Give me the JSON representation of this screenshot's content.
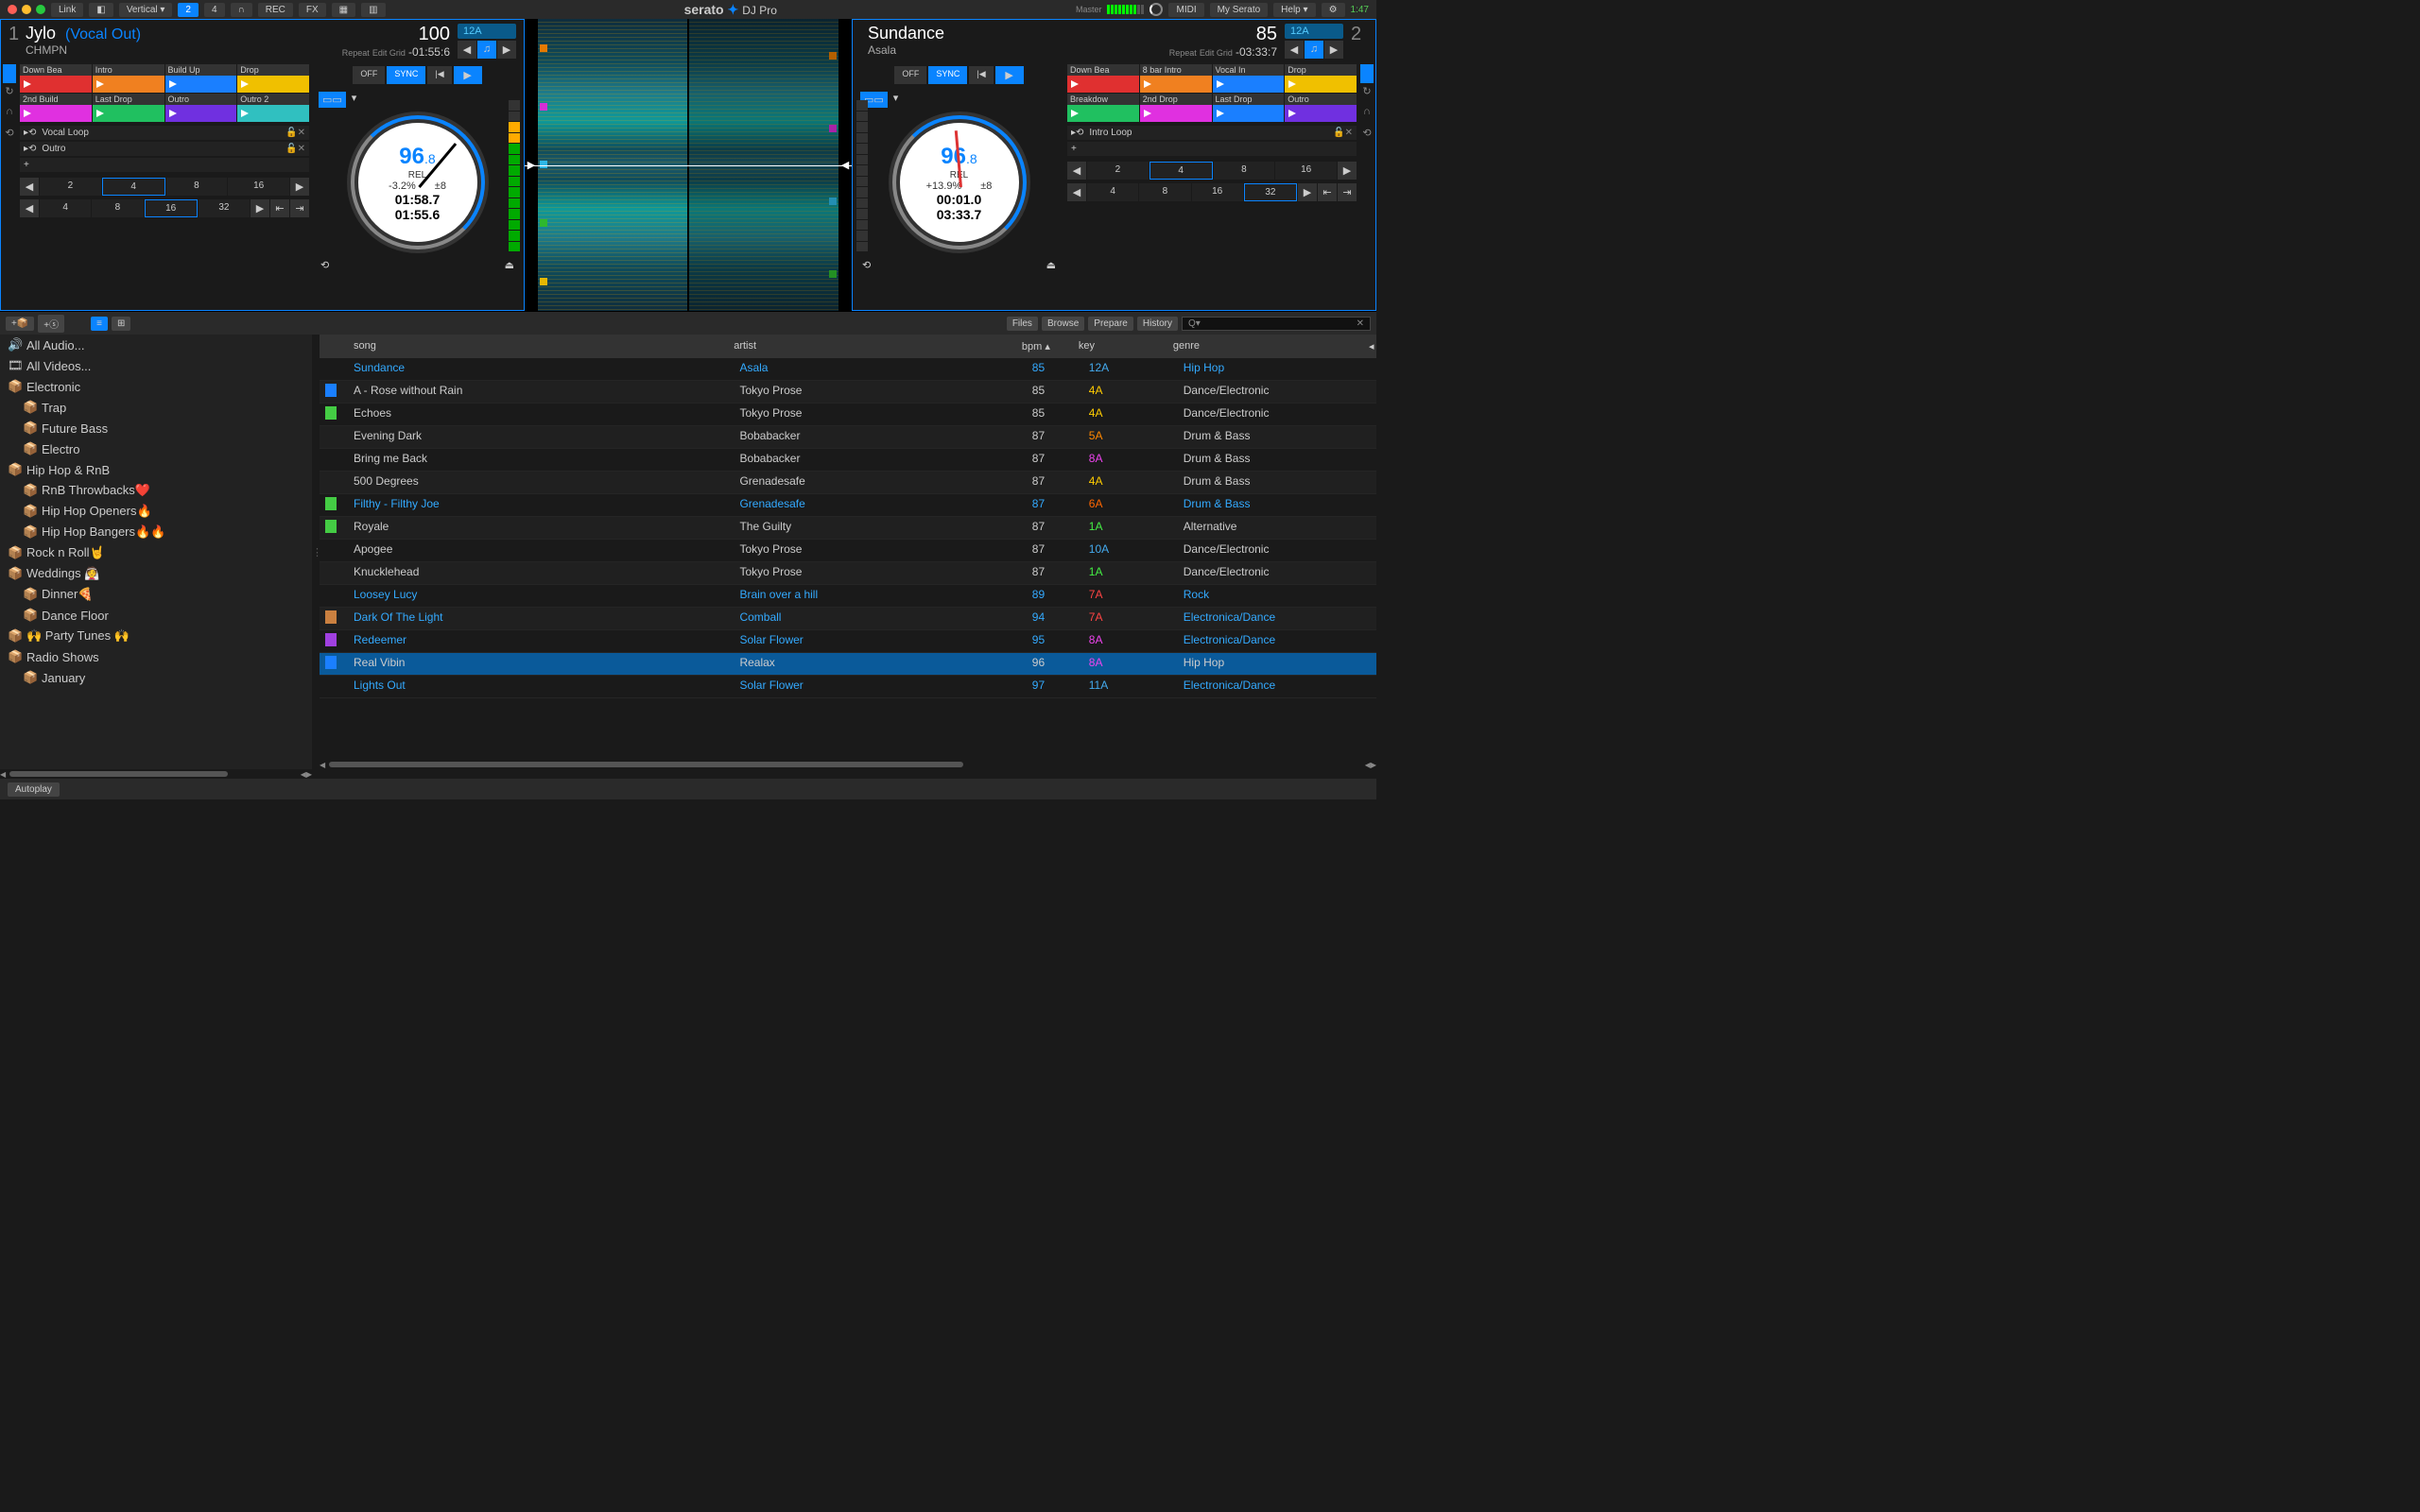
{
  "topbar": {
    "link": "Link",
    "vertical": "Vertical",
    "mode2": "2",
    "mode4": "4",
    "rec": "REC",
    "fx": "FX",
    "master": "Master",
    "midi": "MIDI",
    "myserato": "My Serato",
    "help": "Help",
    "clock": "1:47"
  },
  "brand": {
    "main": "serato",
    "sub": "DJ Pro"
  },
  "deck1": {
    "num": "1",
    "title": "Jylo",
    "artist": "CHMPN",
    "vocal": "(Vocal Out)",
    "bpm": "100",
    "key": "12A",
    "time": "-01:55:6",
    "repeat": "Repeat",
    "editgrid": "Edit Grid",
    "cues": [
      {
        "label": "Down Bea",
        "color": "#e03030"
      },
      {
        "label": "Intro",
        "color": "#f08020"
      },
      {
        "label": "Build Up",
        "color": "#1a7fff"
      },
      {
        "label": "Drop",
        "color": "#f0c000"
      },
      {
        "label": "2nd Build",
        "color": "#e030e0"
      },
      {
        "label": "Last Drop",
        "color": "#20c060"
      },
      {
        "label": "Outro",
        "color": "#7030e0"
      },
      {
        "label": "Outro 2",
        "color": "#30c0c0"
      }
    ],
    "loops": [
      "Vocal Loop",
      "Outro"
    ],
    "beats1": [
      "2",
      "4",
      "8",
      "16"
    ],
    "beats1_active": "4",
    "beats2": [
      "4",
      "8",
      "16",
      "32"
    ],
    "beats2_active": "16",
    "platter_bpm": "96",
    "platter_bpm_dec": ".8",
    "platter_rel": "REL",
    "pitch_pct": "-3.2%",
    "pitch_range": "±8",
    "elapsed": "01:58.7",
    "remain": "01:55.6",
    "off": "OFF",
    "sync": "SYNC"
  },
  "deck2": {
    "num": "2",
    "title": "Sundance",
    "artist": "Asala",
    "bpm": "85",
    "key": "12A",
    "time": "-03:33:7",
    "repeat": "Repeat",
    "editgrid": "Edit Grid",
    "cues": [
      {
        "label": "Down Bea",
        "color": "#e03030"
      },
      {
        "label": "8 bar Intro",
        "color": "#f08020"
      },
      {
        "label": "Vocal In",
        "color": "#1a7fff"
      },
      {
        "label": "Drop",
        "color": "#f0c000"
      },
      {
        "label": "Breakdow",
        "color": "#20c060"
      },
      {
        "label": "2nd Drop",
        "color": "#e030e0"
      },
      {
        "label": "Last Drop",
        "color": "#1a7fff"
      },
      {
        "label": "Outro",
        "color": "#7030e0"
      }
    ],
    "loops": [
      "Intro Loop"
    ],
    "beats1": [
      "2",
      "4",
      "8",
      "16"
    ],
    "beats1_active": "4",
    "beats2": [
      "4",
      "8",
      "16",
      "32"
    ],
    "beats2_active": "32",
    "platter_bpm": "96",
    "platter_bpm_dec": ".8",
    "platter_rel": "REL",
    "pitch_pct": "+13.9%",
    "pitch_range": "±8",
    "elapsed": "00:01.0",
    "remain": "03:33.7",
    "off": "OFF",
    "sync": "SYNC"
  },
  "library_tabs": {
    "files": "Files",
    "browse": "Browse",
    "prepare": "Prepare",
    "history": "History"
  },
  "search_placeholder": "Q▾",
  "crates": [
    {
      "label": "All Audio...",
      "icon": "🔊",
      "indent": 0
    },
    {
      "label": "All Videos...",
      "icon": "🎞",
      "indent": 0
    },
    {
      "label": "Electronic",
      "icon": "📦",
      "indent": 0
    },
    {
      "label": "Trap",
      "icon": "📦",
      "indent": 1
    },
    {
      "label": "Future Bass",
      "icon": "📦",
      "indent": 1
    },
    {
      "label": "Electro",
      "icon": "📦",
      "indent": 1
    },
    {
      "label": "Hip Hop & RnB",
      "icon": "📦",
      "indent": 0
    },
    {
      "label": "RnB Throwbacks❤️",
      "icon": "📦",
      "indent": 1
    },
    {
      "label": "Hip Hop Openers🔥",
      "icon": "📦",
      "indent": 1
    },
    {
      "label": "Hip Hop Bangers🔥🔥",
      "icon": "📦",
      "indent": 1
    },
    {
      "label": "Rock n Roll🤘",
      "icon": "📦",
      "indent": 0
    },
    {
      "label": "Weddings 👰",
      "icon": "📦",
      "indent": 0
    },
    {
      "label": "Dinner🍕",
      "icon": "📦",
      "indent": 1
    },
    {
      "label": "Dance Floor",
      "icon": "📦",
      "indent": 1
    },
    {
      "label": "🙌 Party Tunes 🙌",
      "icon": "📦",
      "indent": 0
    },
    {
      "label": "Radio Shows",
      "icon": "📦",
      "indent": 0
    },
    {
      "label": "January",
      "icon": "📦",
      "indent": 1
    }
  ],
  "columns": {
    "song": "song",
    "artist": "artist",
    "bpm": "bpm",
    "key": "key",
    "genre": "genre"
  },
  "tracks": [
    {
      "song": "Sundance",
      "artist": "Asala",
      "bpm": "85",
      "key": "12A",
      "keycolor": "#4ae",
      "genre": "Hip Hop",
      "mark": "",
      "loaded": true
    },
    {
      "song": "A - Rose without Rain",
      "artist": "Tokyo Prose",
      "bpm": "85",
      "key": "4A",
      "keycolor": "#fc0",
      "genre": "Dance/Electronic",
      "mark": "#1a7fff"
    },
    {
      "song": "Echoes",
      "artist": "Tokyo Prose",
      "bpm": "85",
      "key": "4A",
      "keycolor": "#fc0",
      "genre": "Dance/Electronic",
      "mark": "#4c4"
    },
    {
      "song": "Evening Dark",
      "artist": "Bobabacker",
      "bpm": "87",
      "key": "5A",
      "keycolor": "#f80",
      "genre": "Drum & Bass",
      "mark": ""
    },
    {
      "song": "Bring me Back",
      "artist": "Bobabacker",
      "bpm": "87",
      "key": "8A",
      "keycolor": "#e4e",
      "genre": "Drum & Bass",
      "mark": ""
    },
    {
      "song": "500 Degrees",
      "artist": "Grenadesafe",
      "bpm": "87",
      "key": "4A",
      "keycolor": "#fc0",
      "genre": "Drum & Bass",
      "mark": ""
    },
    {
      "song": "Filthy - Filthy Joe",
      "artist": "Grenadesafe",
      "bpm": "87",
      "key": "6A",
      "keycolor": "#f60",
      "genre": "Drum & Bass",
      "mark": "#4c4",
      "loaded": true
    },
    {
      "song": "Royale",
      "artist": "The Guilty",
      "bpm": "87",
      "key": "1A",
      "keycolor": "#4e4",
      "genre": "Alternative",
      "mark": "#4c4"
    },
    {
      "song": "Apogee",
      "artist": "Tokyo Prose",
      "bpm": "87",
      "key": "10A",
      "keycolor": "#4ae",
      "genre": "Dance/Electronic",
      "mark": ""
    },
    {
      "song": "Knucklehead",
      "artist": "Tokyo Prose",
      "bpm": "87",
      "key": "1A",
      "keycolor": "#4e4",
      "genre": "Dance/Electronic",
      "mark": ""
    },
    {
      "song": "Loosey Lucy",
      "artist": "Brain over a hill",
      "bpm": "89",
      "key": "7A",
      "keycolor": "#f44",
      "genre": "Rock",
      "mark": "",
      "loaded": true
    },
    {
      "song": "Dark Of The Light",
      "artist": "Comball",
      "bpm": "94",
      "key": "7A",
      "keycolor": "#f44",
      "genre": "Electronica/Dance",
      "mark": "#ca8040",
      "loaded": true
    },
    {
      "song": "Redeemer",
      "artist": "Solar Flower",
      "bpm": "95",
      "key": "8A",
      "keycolor": "#e4e",
      "genre": "Electronica/Dance",
      "mark": "#a040e0",
      "loaded": true
    },
    {
      "song": "Real Vibin",
      "artist": "Realax",
      "bpm": "96",
      "key": "8A",
      "keycolor": "#e4e",
      "genre": "Hip Hop",
      "mark": "#1a7fff",
      "selected": true
    },
    {
      "song": "Lights Out",
      "artist": "Solar Flower",
      "bpm": "97",
      "key": "11A",
      "keycolor": "#4ae",
      "genre": "Electronica/Dance",
      "mark": "",
      "loaded": true
    }
  ],
  "autoplay": "Autoplay"
}
